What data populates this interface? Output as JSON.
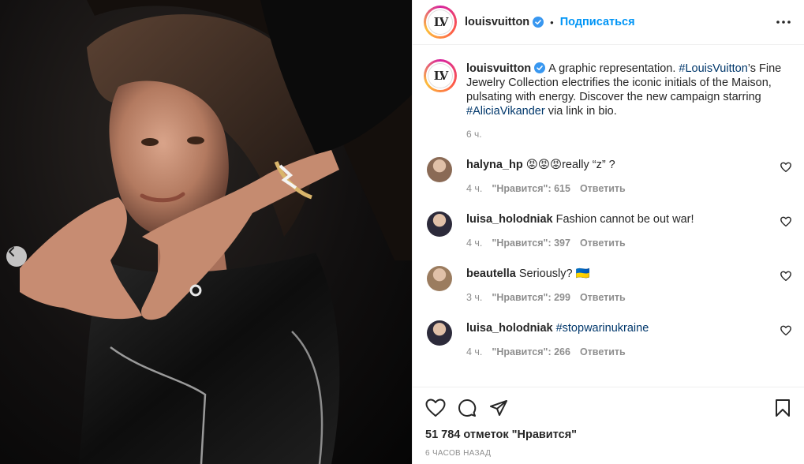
{
  "account": {
    "username": "louisvuitton",
    "avatar_text": "LV",
    "separator": "•",
    "follow_label": "Подписаться"
  },
  "caption": {
    "username": "louisvuitton",
    "text_1": "A graphic representation. ",
    "tag_1": "#LouisVuitton",
    "text_2": "’s Fine Jewelry Collection electrifies the iconic initials of the Maison, pulsating with energy. Discover the new campaign starring ",
    "tag_2": "#AliciaVikander",
    "text_3": " via link in bio.",
    "time": "6 ч."
  },
  "comments": [
    {
      "username": "halyna_hp",
      "text": "😡😡😡really “z” ?",
      "tag": "",
      "time": "4 ч.",
      "likes": "\"Нравится\": 615",
      "reply": "Ответить",
      "avatar_color": "#8a6a55"
    },
    {
      "username": "luisa_holodniak",
      "text": "Fashion cannot be out war!",
      "tag": "",
      "time": "4 ч.",
      "likes": "\"Нравится\": 397",
      "reply": "Ответить",
      "avatar_color": "#2c2a3a"
    },
    {
      "username": "beautella",
      "text": "Seriously? 🇺🇦",
      "tag": "",
      "time": "3 ч.",
      "likes": "\"Нравится\": 299",
      "reply": "Ответить",
      "avatar_color": "#9b7c5f"
    },
    {
      "username": "luisa_holodniak",
      "text": "",
      "tag": "#stopwarinukraine",
      "time": "4 ч.",
      "likes": "\"Нравится\": 266",
      "reply": "Ответить",
      "avatar_color": "#2c2a3a"
    }
  ],
  "footer": {
    "likes_text": "51 784 отметок \"Нравится\"",
    "time_ago": "6 ЧАСОВ НАЗАД"
  },
  "colors": {
    "accent": "#0095f6",
    "hashtag": "#00376b",
    "muted": "#8e8e8e",
    "verified": "#3897f0"
  },
  "icons": {
    "more": "more-horizontal-icon",
    "like": "heart-icon",
    "comment": "comment-bubble-icon",
    "share": "paper-plane-icon",
    "save": "bookmark-icon",
    "prev": "chevron-left-icon",
    "verified": "verified-badge-icon"
  }
}
